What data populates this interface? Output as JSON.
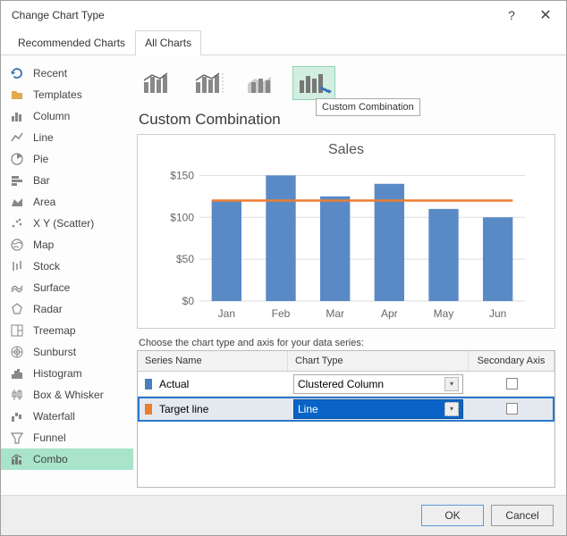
{
  "window": {
    "title": "Change Chart Type",
    "help": "?",
    "close": "✕"
  },
  "tabs": {
    "recommended": "Recommended Charts",
    "all": "All Charts"
  },
  "sidebar": [
    {
      "label": "Recent"
    },
    {
      "label": "Templates"
    },
    {
      "label": "Column"
    },
    {
      "label": "Line"
    },
    {
      "label": "Pie"
    },
    {
      "label": "Bar"
    },
    {
      "label": "Area"
    },
    {
      "label": "X Y (Scatter)"
    },
    {
      "label": "Map"
    },
    {
      "label": "Stock"
    },
    {
      "label": "Surface"
    },
    {
      "label": "Radar"
    },
    {
      "label": "Treemap"
    },
    {
      "label": "Sunburst"
    },
    {
      "label": "Histogram"
    },
    {
      "label": "Box & Whisker"
    },
    {
      "label": "Waterfall"
    },
    {
      "label": "Funnel"
    },
    {
      "label": "Combo"
    }
  ],
  "section_title": "Custom Combination",
  "tooltip": "Custom Combination",
  "chart": {
    "title": "Sales"
  },
  "series_label": "Choose the chart type and axis for your data series:",
  "grid": {
    "head": {
      "name": "Series Name",
      "type": "Chart Type",
      "axis": "Secondary Axis"
    },
    "rows": [
      {
        "name": "Actual",
        "type": "Clustered Column",
        "color": "#4a7ebb",
        "selected": false
      },
      {
        "name": "Target line",
        "type": "Line",
        "color": "#ed7d31",
        "selected": true
      }
    ]
  },
  "buttons": {
    "ok": "OK",
    "cancel": "Cancel"
  },
  "chart_data": {
    "type": "bar",
    "title": "Sales",
    "xlabel": "",
    "ylabel": "",
    "ylim": [
      0,
      160
    ],
    "yticks": [
      0,
      50,
      100,
      150
    ],
    "categories": [
      "Jan",
      "Feb",
      "Mar",
      "Apr",
      "May",
      "Jun"
    ],
    "series": [
      {
        "name": "Actual",
        "type": "bar",
        "color": "#5a8ac6",
        "values": [
          120,
          150,
          125,
          140,
          110,
          100
        ]
      },
      {
        "name": "Target line",
        "type": "line",
        "color": "#ed7d31",
        "values": [
          120,
          120,
          120,
          120,
          120,
          120
        ]
      }
    ]
  }
}
